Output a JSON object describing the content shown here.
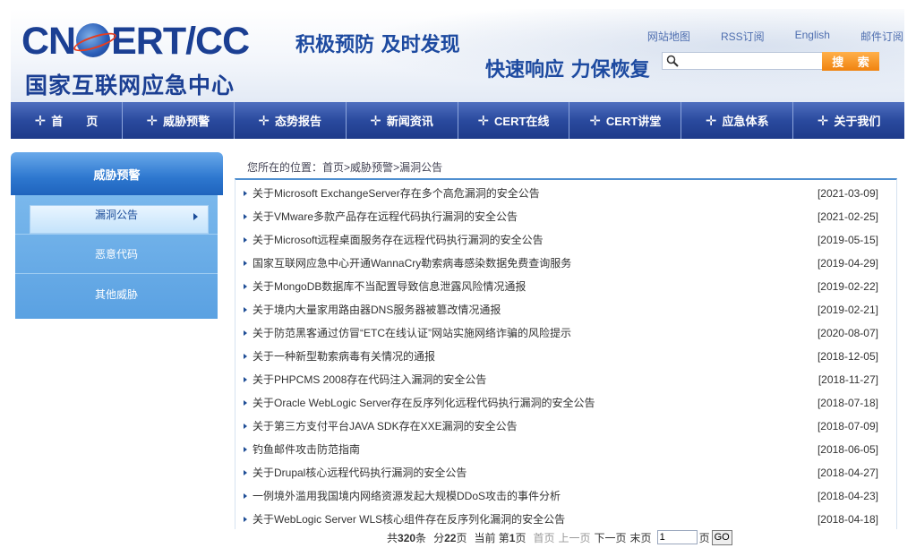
{
  "header": {
    "logo_en_part1": "CN",
    "logo_en_part2": "ERT/CC",
    "logo_zh": "国家互联网应急中心",
    "slogan1": "积极预防 及时发现",
    "slogan2": "快速响应 力保恢复",
    "links": [
      "网站地图",
      "RSS订阅",
      "English",
      "邮件订阅"
    ],
    "search_placeholder": "",
    "search_button": "搜 索"
  },
  "nav": {
    "items": [
      "首　　页",
      "威胁预警",
      "态势报告",
      "新闻资讯",
      "CERT在线",
      "CERT讲堂",
      "应急体系",
      "关于我们"
    ]
  },
  "sidebar": {
    "title": "威胁预警",
    "items": [
      "漏洞公告",
      "恶意代码",
      "其他威胁"
    ],
    "active_index": 0
  },
  "breadcrumb": {
    "prefix": "您所在的位置：",
    "parts": [
      "首页",
      "威胁预警",
      "漏洞公告"
    ],
    "sep": ">"
  },
  "articles": [
    {
      "title": "关于Microsoft ExchangeServer存在多个高危漏洞的安全公告",
      "date": "[2021-03-09]"
    },
    {
      "title": "关于VMware多款产品存在远程代码执行漏洞的安全公告",
      "date": "[2021-02-25]"
    },
    {
      "title": "关于Microsoft远程桌面服务存在远程代码执行漏洞的安全公告",
      "date": "[2019-05-15]"
    },
    {
      "title": "国家互联网应急中心开通WannaCry勒索病毒感染数据免费查询服务",
      "date": "[2019-04-29]"
    },
    {
      "title": "关于MongoDB数据库不当配置导致信息泄露风险情况通报",
      "date": "[2019-02-22]"
    },
    {
      "title": "关于境内大量家用路由器DNS服务器被篡改情况通报",
      "date": "[2019-02-21]"
    },
    {
      "title": "关于防范黑客通过仿冒“ETC在线认证”网站实施网络诈骗的风险提示",
      "date": "[2020-08-07]"
    },
    {
      "title": "关于一种新型勒索病毒有关情况的通报",
      "date": "[2018-12-05]"
    },
    {
      "title": "关于PHPCMS 2008存在代码注入漏洞的安全公告",
      "date": "[2018-11-27]"
    },
    {
      "title": "关于Oracle WebLogic Server存在反序列化远程代码执行漏洞的安全公告",
      "date": "[2018-07-18]"
    },
    {
      "title": "关于第三方支付平台JAVA SDK存在XXE漏洞的安全公告",
      "date": "[2018-07-09]"
    },
    {
      "title": "钓鱼邮件攻击防范指南",
      "date": "[2018-06-05]"
    },
    {
      "title": "关于Drupal核心远程代码执行漏洞的安全公告",
      "date": "[2018-04-27]"
    },
    {
      "title": "一例境外滥用我国境内网络资源发起大规模DDoS攻击的事件分析",
      "date": "[2018-04-23]"
    },
    {
      "title": "关于WebLogic Server WLS核心组件存在反序列化漏洞的安全公告",
      "date": "[2018-04-18]"
    }
  ],
  "pager": {
    "total_prefix": "共",
    "total": "320",
    "total_suffix": "条",
    "pages_prefix": "分",
    "pages": "22",
    "pages_suffix": "页",
    "current_prefix": "当前 第",
    "current": "1",
    "current_suffix": "页",
    "first": "首页",
    "prev": "上一页",
    "next": "下一页",
    "last": "末页",
    "goto_value": "1",
    "goto_suffix": "页",
    "go_button": "GO"
  },
  "colors": {
    "brand": "#1b3f93",
    "nav": "#2a4a9e",
    "sidebar": "#5aa1e2",
    "search_button": "#f0830f"
  }
}
